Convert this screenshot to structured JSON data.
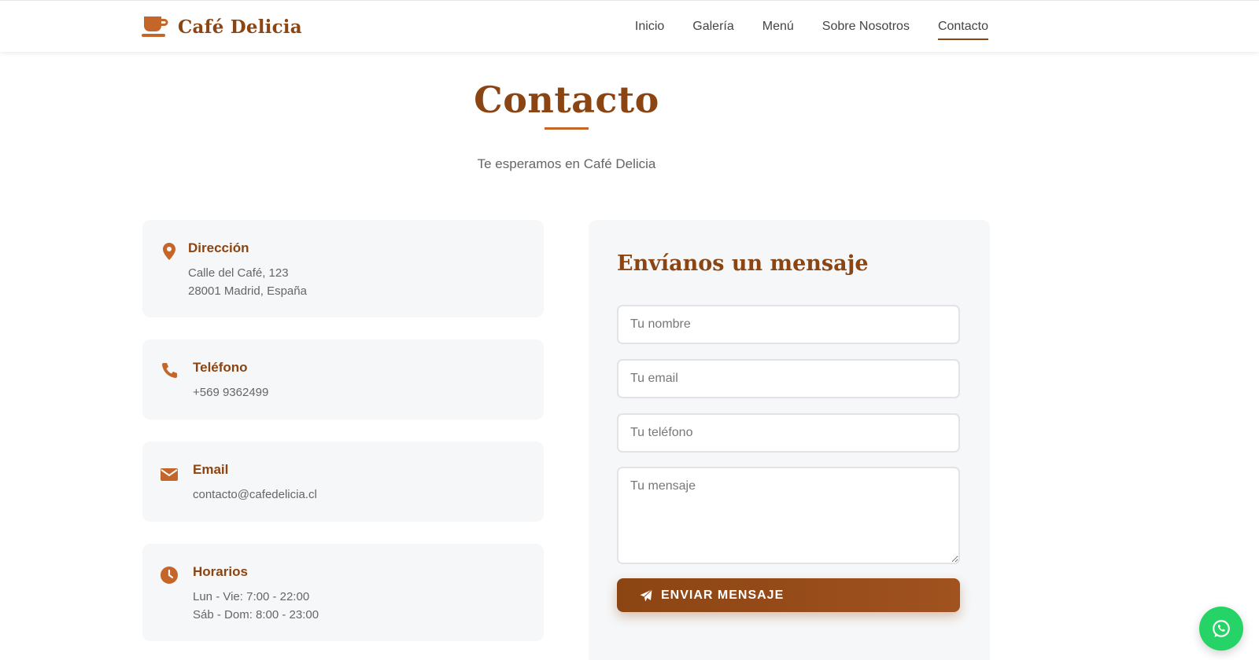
{
  "brand": {
    "name": "Café Delicia",
    "icon": "coffee-cup-icon"
  },
  "nav": {
    "items": [
      {
        "label": "Inicio"
      },
      {
        "label": "Galería"
      },
      {
        "label": "Menú"
      },
      {
        "label": "Sobre Nosotros"
      },
      {
        "label": "Contacto",
        "active": true
      }
    ]
  },
  "hero": {
    "title": "Contacto",
    "subtitle": "Te esperamos en Café Delicia"
  },
  "info": {
    "address": {
      "heading": "Dirección",
      "line1": "Calle del Café, 123",
      "line2": "28001 Madrid, España",
      "icon": "map-pin-icon"
    },
    "phone": {
      "heading": "Teléfono",
      "line1": "+569 9362499",
      "icon": "phone-icon"
    },
    "email": {
      "heading": "Email",
      "line1": "contacto@cafedelicia.cl",
      "icon": "envelope-icon"
    },
    "hours": {
      "heading": "Horarios",
      "line1": "Lun - Vie: 7:00 - 22:00",
      "line2": "Sáb - Dom: 8:00 - 23:00",
      "icon": "clock-icon"
    }
  },
  "form": {
    "title": "Envíanos un mensaje",
    "name_placeholder": "Tu nombre",
    "email_placeholder": "Tu email",
    "phone_placeholder": "Tu teléfono",
    "message_placeholder": "Tu mensaje",
    "submit_label": "ENVIAR MENSAJE"
  },
  "colors": {
    "brand": "#8b4513",
    "accent": "#c4662a",
    "whatsapp": "#25d366",
    "card_bg": "#f6f7f8"
  }
}
